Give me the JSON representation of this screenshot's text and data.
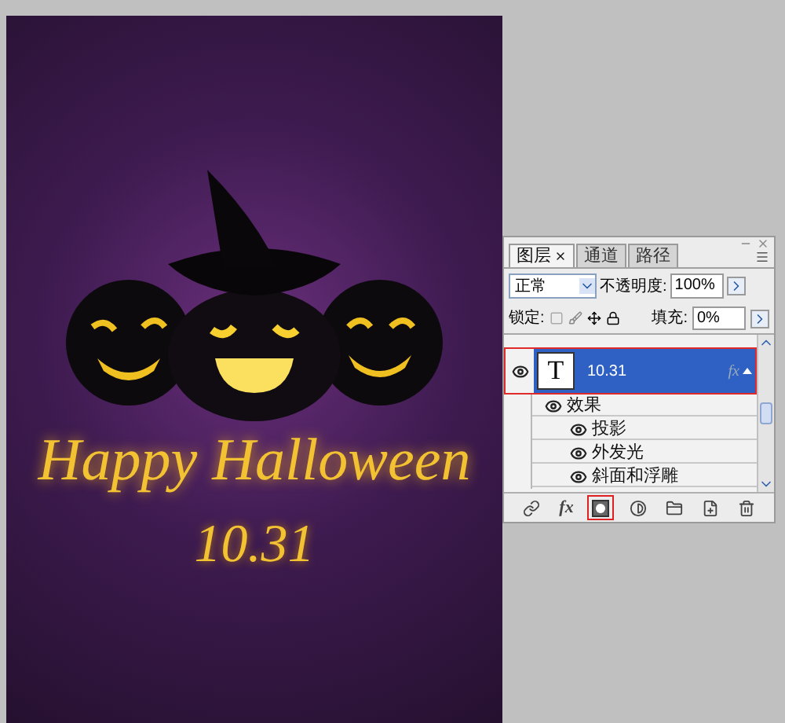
{
  "canvas": {
    "greeting": "Happy Halloween",
    "date": "10.31"
  },
  "layers_panel": {
    "tabs": [
      {
        "label": "图层",
        "selected": true,
        "closable": true
      },
      {
        "label": "通道",
        "selected": false,
        "closable": false
      },
      {
        "label": "路径",
        "selected": false,
        "closable": false
      }
    ],
    "blend_mode": "正常",
    "opacity": {
      "label": "不透明度:",
      "value": "100%"
    },
    "lock": {
      "label": "锁定:"
    },
    "fill": {
      "label": "填充:",
      "value": "0%"
    },
    "layers": [
      {
        "kind": "text",
        "thumbnail": "T",
        "name": "10.31",
        "visible": true,
        "selected": true,
        "highlighted": true,
        "effects_badge": "fx",
        "expanded": true,
        "children": [
          {
            "name": "效果",
            "visible": true,
            "children": [
              {
                "name": "投影",
                "visible": true
              },
              {
                "name": "外发光",
                "visible": true
              },
              {
                "name": "斜面和浮雕",
                "visible": true
              }
            ]
          }
        ]
      }
    ],
    "toolbar": [
      {
        "kind": "link",
        "highlighted": false
      },
      {
        "kind": "fx",
        "label": "fx",
        "highlighted": false
      },
      {
        "kind": "mask",
        "highlighted": true
      },
      {
        "kind": "adjustment",
        "highlighted": false
      },
      {
        "kind": "group",
        "highlighted": false
      },
      {
        "kind": "new",
        "highlighted": false
      },
      {
        "kind": "delete",
        "highlighted": false
      }
    ]
  }
}
